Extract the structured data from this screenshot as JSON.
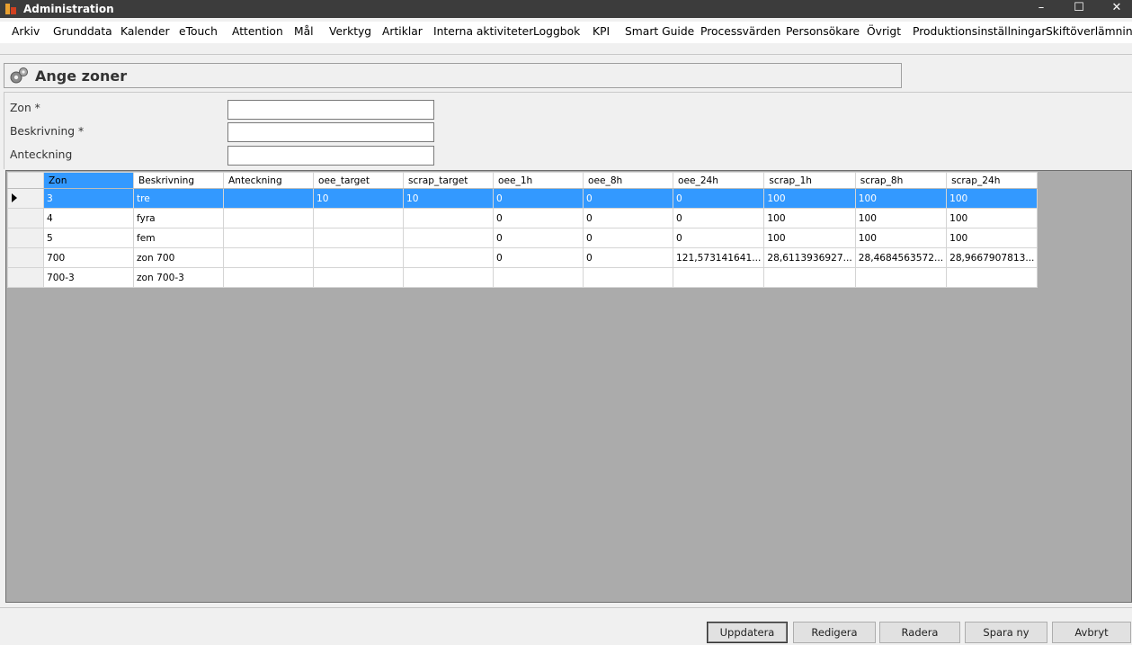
{
  "window": {
    "title": "Administration",
    "minimize": "–",
    "maximize": "☐",
    "close": "✕"
  },
  "menu": [
    "Arkiv",
    "Grunddata",
    "Kalender",
    "eTouch",
    "Attention",
    "Mål",
    "Verktyg",
    "Artiklar",
    "Interna aktiviteter",
    "Loggbok",
    "KPI",
    "Smart Guide",
    "Processvärden",
    "Personsökare",
    "Övrigt",
    "Produktionsinställningar",
    "Skiftöverlämning"
  ],
  "page": {
    "title": "Ange zoner"
  },
  "form": {
    "zon_label": "Zon *",
    "beskrivning_label": "Beskrivning *",
    "anteckning_label": "Anteckning",
    "zon_value": "",
    "beskrivning_value": "",
    "anteckning_value": ""
  },
  "grid": {
    "columns": [
      "Zon",
      "Beskrivning",
      "Anteckning",
      "oee_target",
      "scrap_target",
      "oee_1h",
      "oee_8h",
      "oee_24h",
      "scrap_1h",
      "scrap_8h",
      "scrap_24h"
    ],
    "rows": [
      [
        "3",
        "tre",
        "",
        "10",
        "10",
        "0",
        "0",
        "0",
        "100",
        "100",
        "100"
      ],
      [
        "4",
        "fyra",
        "",
        "",
        "",
        "0",
        "0",
        "0",
        "100",
        "100",
        "100"
      ],
      [
        "5",
        "fem",
        "",
        "",
        "",
        "0",
        "0",
        "0",
        "100",
        "100",
        "100"
      ],
      [
        "700",
        "zon 700",
        "",
        "",
        "",
        "0",
        "0",
        "121,573141641...",
        "28,6113936927...",
        "28,4684563572...",
        "28,9667907813..."
      ],
      [
        "700-3",
        "zon 700-3",
        "",
        "",
        "",
        "",
        "",
        "",
        "",
        "",
        ""
      ]
    ],
    "selected_row": 0
  },
  "buttons": {
    "uppdatera": "Uppdatera",
    "redigera": "Redigera",
    "radera": "Radera",
    "spara_ny": "Spara ny",
    "avbryt": "Avbryt"
  }
}
